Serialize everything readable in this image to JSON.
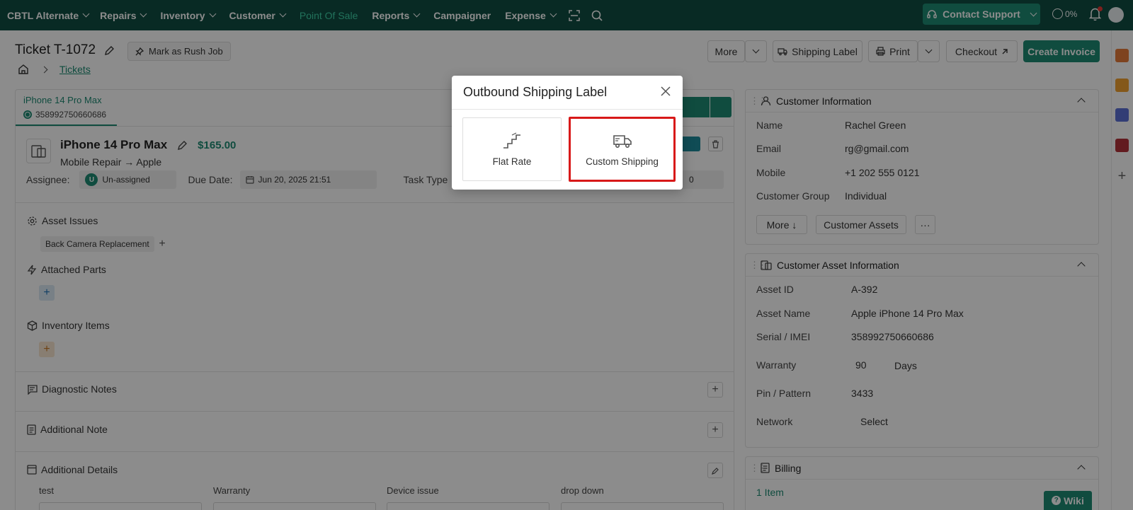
{
  "topnav": {
    "brand": "CBTL Alternate",
    "items": [
      {
        "label": "Repairs",
        "dropdown": true
      },
      {
        "label": "Inventory",
        "dropdown": true
      },
      {
        "label": "Customer",
        "dropdown": true
      },
      {
        "label": "Point Of Sale",
        "dropdown": false,
        "active": true
      },
      {
        "label": "Reports",
        "dropdown": true
      },
      {
        "label": "Campaigner",
        "dropdown": false
      },
      {
        "label": "Expense",
        "dropdown": true
      }
    ],
    "support_label": "Contact Support",
    "progress_label": "0%"
  },
  "header": {
    "title": "Ticket T-1072",
    "rush_label": "Mark as Rush Job",
    "breadcrumb_link": "Tickets",
    "more_label": "More",
    "shipping_label": "Shipping Label",
    "print_label": "Print",
    "checkout_label": "Checkout",
    "create_invoice_label": "Create Invoice"
  },
  "device": {
    "tab_name": "iPhone 14 Pro Max",
    "tab_imei": "358992750660686",
    "name": "iPhone 14 Pro Max",
    "price": "$165.00",
    "subtitle": "Mobile Repair → Apple",
    "assignee_label": "Assignee:",
    "assignee_badge": "U",
    "assignee_value": "Un-assigned",
    "due_label": "Due Date:",
    "due_value": "Jun 20, 2025 21:51",
    "task_type_label": "Task Type",
    "status_value": "0"
  },
  "sections": {
    "asset_issues": "Asset Issues",
    "issue_chip": "Back Camera Replacement",
    "attached_parts": "Attached Parts",
    "inventory_items": "Inventory Items",
    "diagnostic_notes": "Diagnostic Notes",
    "additional_note": "Additional Note",
    "additional_details": "Additional Details",
    "detail_fields": [
      "test",
      "Warranty",
      "Device issue",
      "drop down"
    ]
  },
  "customer": {
    "title": "Customer Information",
    "rows": [
      {
        "label": "Name",
        "value": "Rachel Green"
      },
      {
        "label": "Email",
        "value": "rg@gmail.com"
      },
      {
        "label": "Mobile",
        "value": "+1 202 555 0121"
      },
      {
        "label": "Customer Group",
        "value": "Individual"
      }
    ],
    "more_label": "More ↓",
    "assets_label": "Customer Assets",
    "ellipsis": "···"
  },
  "asset": {
    "title": "Customer Asset Information",
    "rows": [
      {
        "label": "Asset ID",
        "value": "A-392"
      },
      {
        "label": "Asset Name",
        "value": "Apple iPhone 14 Pro Max"
      },
      {
        "label": "Serial / IMEI",
        "value": "358992750660686"
      },
      {
        "label": "Warranty",
        "value": "90"
      },
      {
        "label": "Pin / Pattern",
        "value": "3433"
      },
      {
        "label": "Network",
        "value": "Select"
      }
    ],
    "warranty_unit": "Days"
  },
  "billing": {
    "title": "Billing",
    "items_label": "1 Item"
  },
  "wiki_label": "Wiki",
  "modal": {
    "title": "Outbound Shipping Label",
    "options": [
      {
        "label": "Flat Rate",
        "icon": "stairs-icon"
      },
      {
        "label": "Custom Shipping",
        "icon": "truck-icon",
        "selected": true
      }
    ]
  },
  "colors": {
    "nav_bg": "#0f4d43",
    "accent": "#1e8a73",
    "selection_outline": "#d81919"
  }
}
